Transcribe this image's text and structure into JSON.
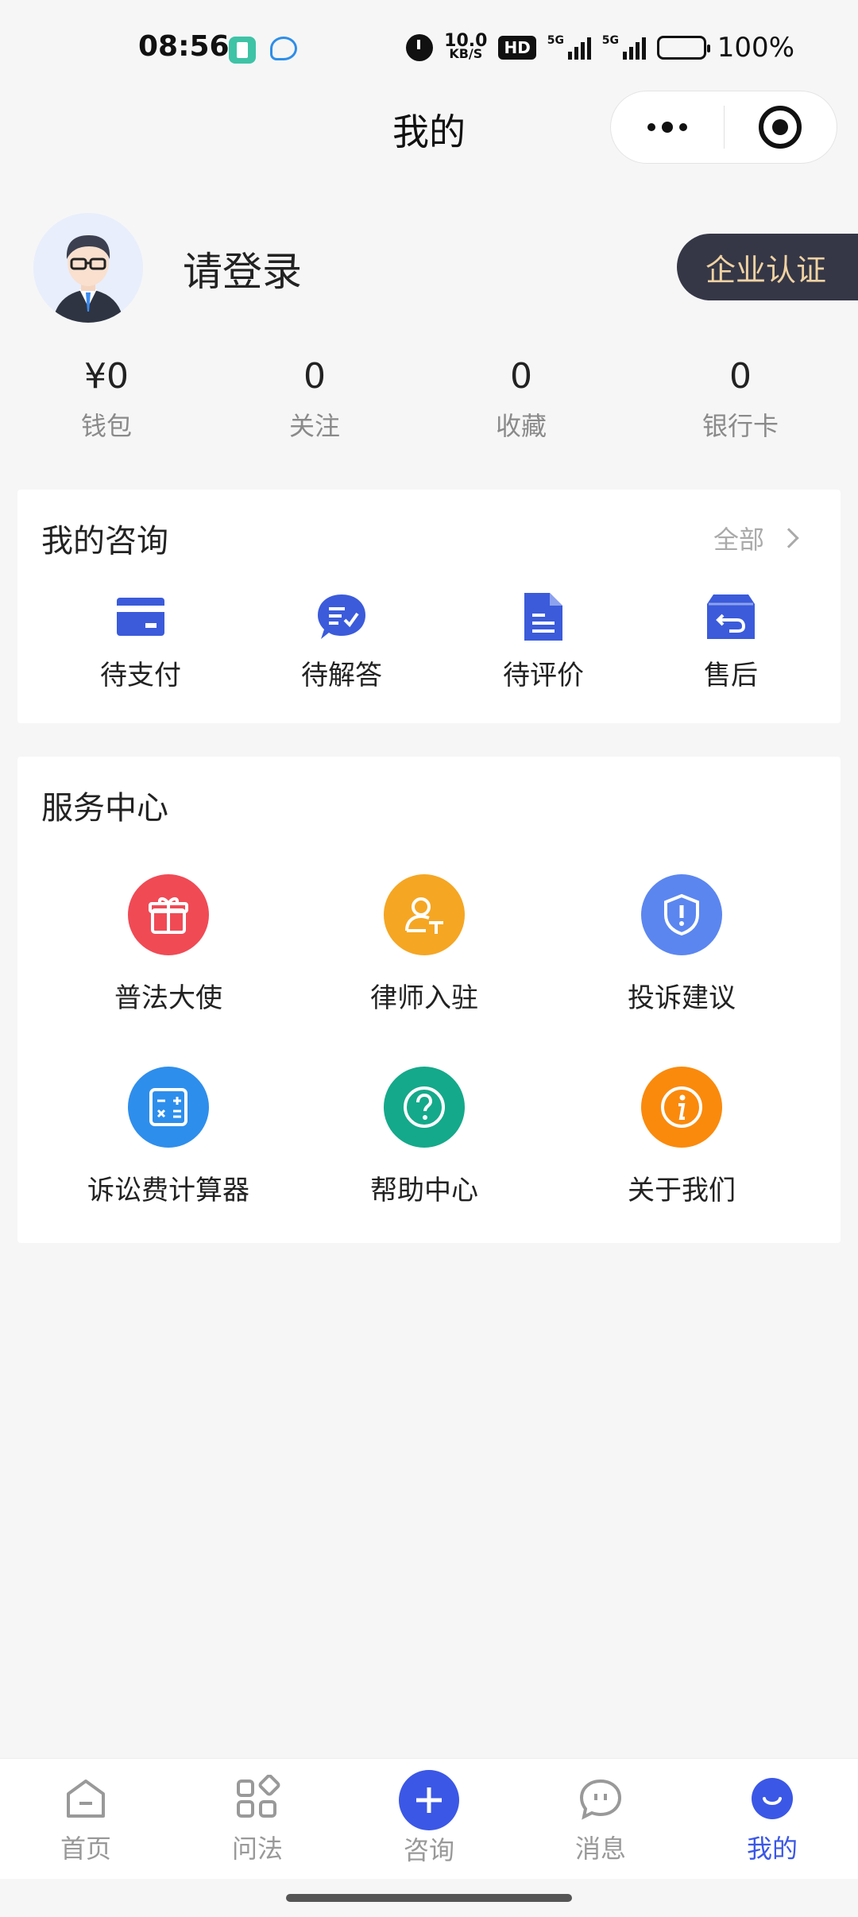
{
  "status_bar": {
    "time": "08:56",
    "speed_value": "10.0",
    "speed_unit": "KB/S",
    "hd_label": "HD",
    "signal1_label": "5G",
    "signal2_label": "5G",
    "battery": "100%",
    "icons": [
      "app-icon",
      "chat-icon",
      "alarm-icon",
      "signal-icon",
      "battery-icon"
    ]
  },
  "header": {
    "title": "我的",
    "capsule_icons": [
      "more-icon",
      "close-target-icon"
    ]
  },
  "profile": {
    "login_text": "请登录",
    "enterprise_button": "企业认证"
  },
  "stats": [
    {
      "value": "¥0",
      "label": "钱包"
    },
    {
      "value": "0",
      "label": "关注"
    },
    {
      "value": "0",
      "label": "收藏"
    },
    {
      "value": "0",
      "label": "银行卡"
    }
  ],
  "consult": {
    "title": "我的咨询",
    "all_label": "全部",
    "items": [
      {
        "label": "待支付",
        "icon": "card-icon"
      },
      {
        "label": "待解答",
        "icon": "chat-bubble-icon"
      },
      {
        "label": "待评价",
        "icon": "document-icon"
      },
      {
        "label": "售后",
        "icon": "return-box-icon"
      }
    ],
    "accent": "#3b5bdb"
  },
  "service": {
    "title": "服务中心",
    "items": [
      {
        "label": "普法大使",
        "icon": "gift-icon",
        "color": "#f04a55"
      },
      {
        "label": "律师入驻",
        "icon": "lawyer-icon",
        "color": "#f5a623"
      },
      {
        "label": "投诉建议",
        "icon": "shield-icon",
        "color": "#5b86f0"
      },
      {
        "label": "诉讼费计算器",
        "icon": "calculator-icon",
        "color": "#2e8eec"
      },
      {
        "label": "帮助中心",
        "icon": "question-icon",
        "color": "#14a98a"
      },
      {
        "label": "关于我们",
        "icon": "info-icon",
        "color": "#fa8a0c"
      }
    ]
  },
  "bottom_nav": {
    "items": [
      {
        "label": "首页",
        "icon": "home-icon"
      },
      {
        "label": "问法",
        "icon": "grid-icon"
      },
      {
        "label": "咨询",
        "icon": "plus-icon"
      },
      {
        "label": "消息",
        "icon": "message-icon"
      },
      {
        "label": "我的",
        "icon": "profile-icon"
      }
    ],
    "active_index": 4,
    "active_color": "#3b57e6"
  }
}
